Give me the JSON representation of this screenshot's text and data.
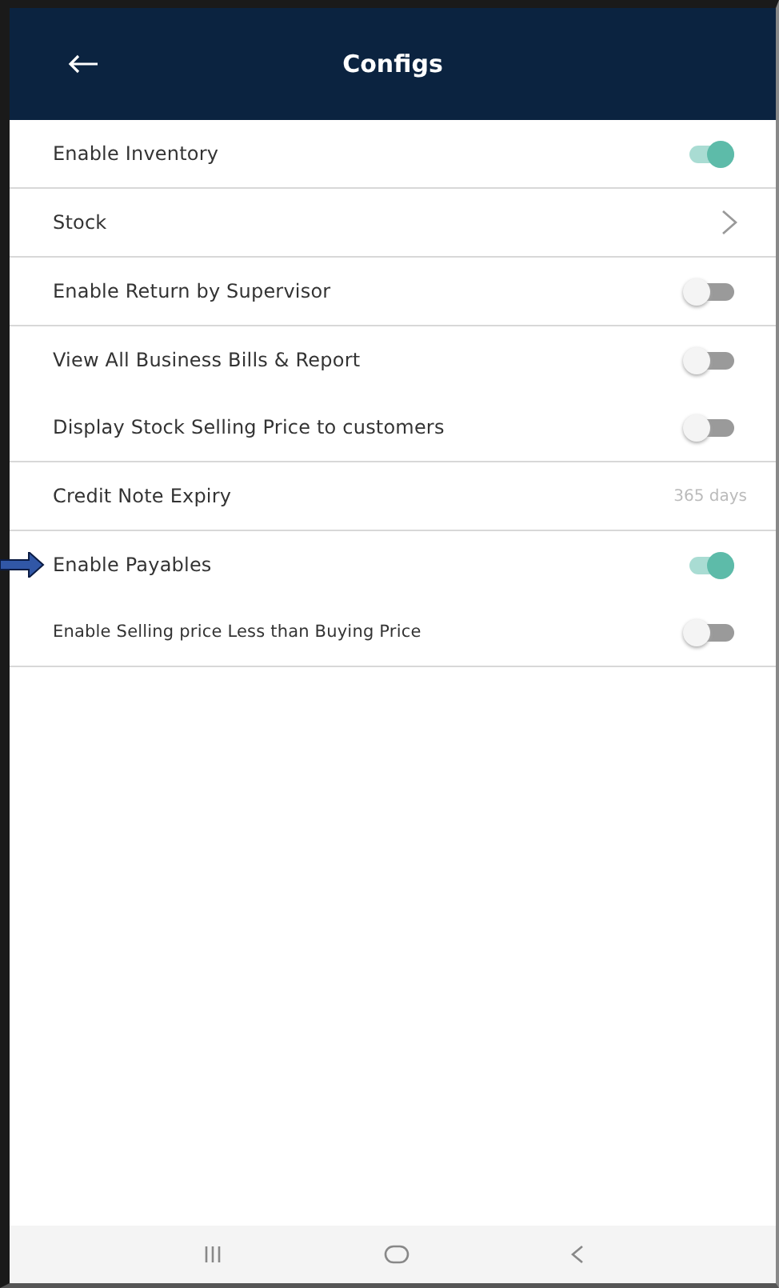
{
  "header": {
    "title": "Configs"
  },
  "sections": [
    {
      "rows": [
        {
          "kind": "toggle",
          "label": "Enable Inventory",
          "on": true
        }
      ]
    },
    {
      "rows": [
        {
          "kind": "link",
          "label": "Stock"
        }
      ]
    },
    {
      "rows": [
        {
          "kind": "toggle",
          "label": "Enable Return by Supervisor",
          "on": false
        }
      ]
    },
    {
      "rows": [
        {
          "kind": "toggle",
          "label": "View All Business Bills & Report",
          "on": false
        },
        {
          "kind": "toggle",
          "label": "Display Stock Selling Price to customers",
          "on": false
        }
      ]
    },
    {
      "rows": [
        {
          "kind": "value",
          "label": "Credit Note Expiry",
          "value": "365 days"
        }
      ]
    },
    {
      "rows": [
        {
          "kind": "toggle",
          "label": "Enable Payables",
          "on": true,
          "pointed": true
        },
        {
          "kind": "toggle",
          "label": "Enable Selling price Less than Buying Price",
          "on": false,
          "small": true
        }
      ]
    }
  ]
}
